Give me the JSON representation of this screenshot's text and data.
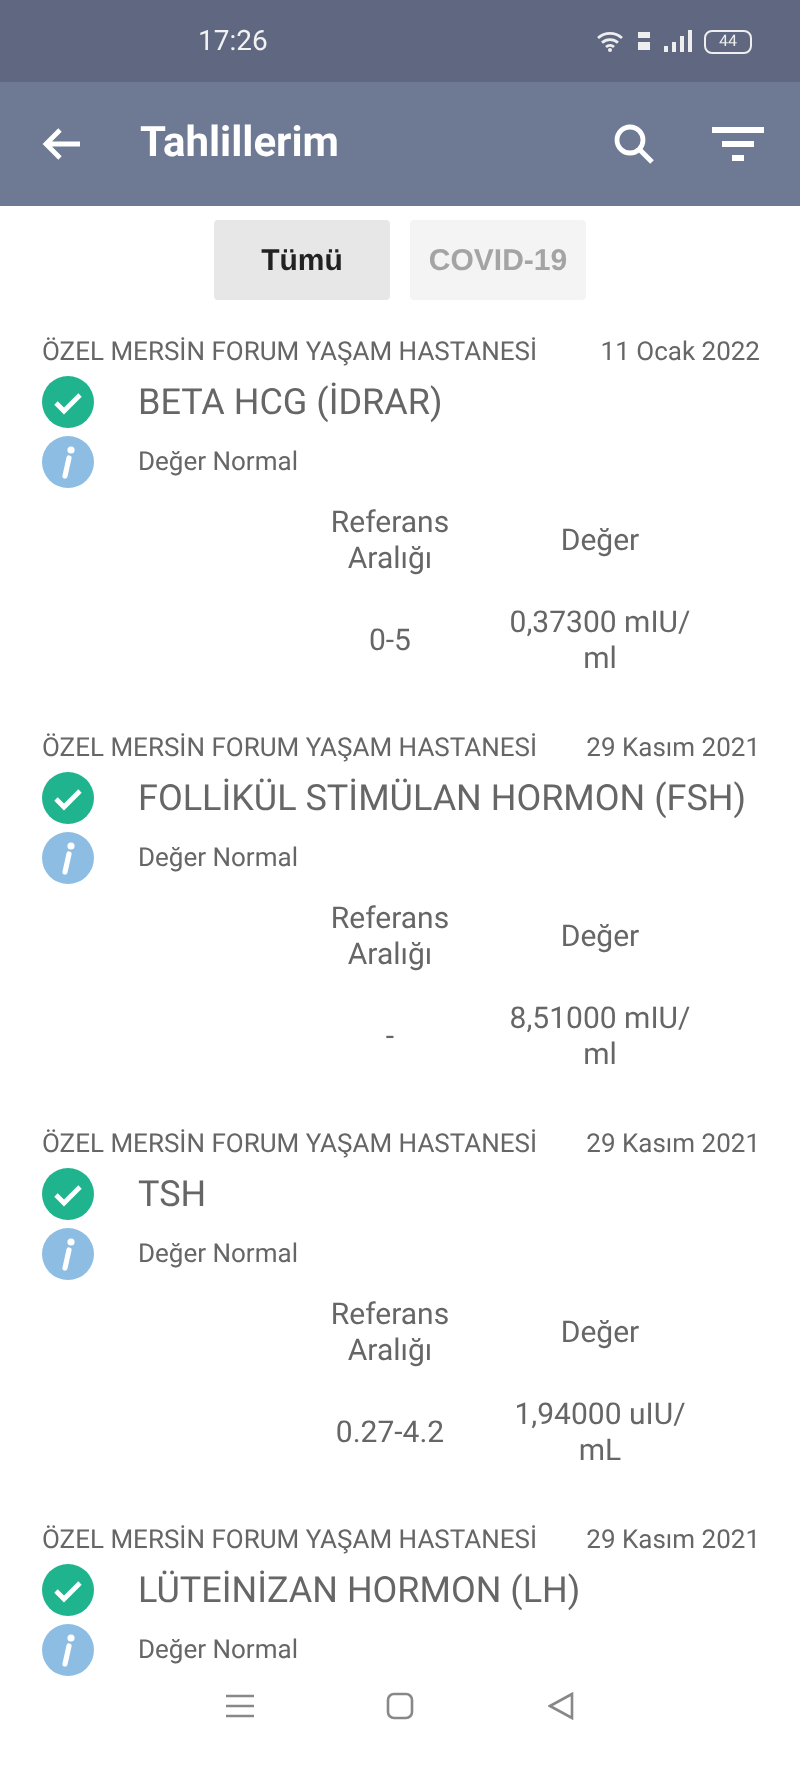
{
  "status_bar": {
    "time": "17:26",
    "battery": "44"
  },
  "app_bar": {
    "title": "Tahlillerim"
  },
  "tabs": [
    {
      "label": "Tümü",
      "selected": true
    },
    {
      "label": "COVID-19",
      "selected": false
    }
  ],
  "results": [
    {
      "hospital": "ÖZEL MERSİN FORUM YAŞAM HASTANESİ",
      "date": "11 Ocak 2022",
      "test": "BETA HCG (İDRAR)",
      "status": "Değer Normal",
      "reference_header": "Referans Aralığı",
      "value_header": "Değer",
      "reference": "0-5",
      "value": "0,37300 mIU/ ml"
    },
    {
      "hospital": "ÖZEL MERSİN FORUM YAŞAM HASTANESİ",
      "date": "29 Kasım 2021",
      "test": "FOLLİKÜL STİMÜLAN HORMON (FSH)",
      "status": "Değer Normal",
      "reference_header": "Referans Aralığı",
      "value_header": "Değer",
      "reference": "-",
      "value": "8,51000 mIU/ ml"
    },
    {
      "hospital": "ÖZEL MERSİN FORUM YAŞAM HASTANESİ",
      "date": "29 Kasım 2021",
      "test": "TSH",
      "status": "Değer Normal",
      "reference_header": "Referans Aralığı",
      "value_header": "Değer",
      "reference": "0.27-4.2",
      "value": "1,94000 uIU/ mL"
    },
    {
      "hospital": "ÖZEL MERSİN FORUM YAŞAM HASTANESİ",
      "date": "29 Kasım 2021",
      "test": "LÜTEİNİZAN HORMON (LH)",
      "status": "Değer Normal"
    }
  ]
}
